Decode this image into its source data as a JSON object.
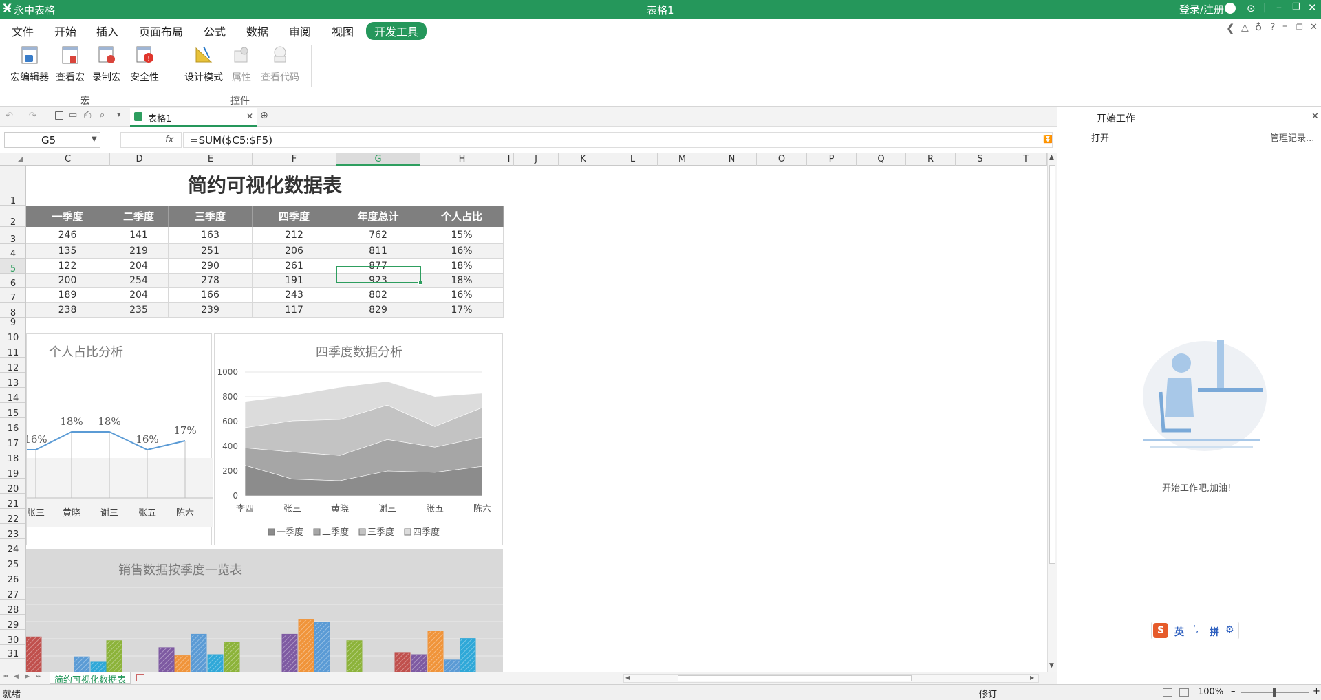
{
  "app": {
    "name": "永中表格",
    "doc_title": "表格1",
    "login": "登录/注册"
  },
  "menu": [
    "文件",
    "开始",
    "插入",
    "页面布局",
    "公式",
    "数据",
    "审阅",
    "视图",
    "开发工具"
  ],
  "ribbon": {
    "groups": [
      {
        "label": "宏"
      },
      {
        "label": "控件"
      }
    ],
    "buttons": [
      {
        "label": "宏编辑器",
        "icon": "macro-editor-icon",
        "enabled": true
      },
      {
        "label": "查看宏",
        "icon": "view-macro-icon",
        "enabled": true
      },
      {
        "label": "录制宏",
        "icon": "record-macro-icon",
        "enabled": true
      },
      {
        "label": "安全性",
        "icon": "security-icon",
        "enabled": true
      },
      {
        "label": "设计模式",
        "icon": "design-mode-icon",
        "enabled": true
      },
      {
        "label": "属性",
        "icon": "properties-icon",
        "enabled": false
      },
      {
        "label": "查看代码",
        "icon": "view-code-icon",
        "enabled": false
      }
    ]
  },
  "doc_tab": {
    "label": "表格1"
  },
  "formula_bar": {
    "name_box": "G5",
    "fx": "fx",
    "formula": "=SUM($C5:$F5)"
  },
  "columns": [
    "C",
    "D",
    "E",
    "F",
    "G",
    "H",
    "I",
    "J",
    "K",
    "L",
    "M",
    "N",
    "O",
    "P",
    "Q",
    "R",
    "S",
    "T"
  ],
  "rows": [
    "1",
    "2",
    "3",
    "4",
    "5",
    "6",
    "7",
    "8",
    "9",
    "10",
    "11",
    "12",
    "13",
    "14",
    "15",
    "16",
    "17",
    "18",
    "19",
    "20",
    "21",
    "22",
    "23",
    "24",
    "25",
    "26",
    "27",
    "28",
    "29",
    "30",
    "31"
  ],
  "sheet": {
    "title": "简约可视化数据表",
    "headers": [
      "一季度",
      "二季度",
      "三季度",
      "四季度",
      "年度总计",
      "个人占比"
    ],
    "data": [
      [
        "246",
        "141",
        "163",
        "212",
        "762",
        "15%"
      ],
      [
        "135",
        "219",
        "251",
        "206",
        "811",
        "16%"
      ],
      [
        "122",
        "204",
        "290",
        "261",
        "877",
        "18%"
      ],
      [
        "200",
        "254",
        "278",
        "191",
        "923",
        "18%"
      ],
      [
        "189",
        "204",
        "166",
        "243",
        "802",
        "16%"
      ],
      [
        "238",
        "235",
        "239",
        "117",
        "829",
        "17%"
      ]
    ]
  },
  "chart_data": [
    {
      "type": "line",
      "title": "个人占比分析",
      "categories": [
        "张三",
        "黄晓",
        "谢三",
        "张五",
        "陈六"
      ],
      "visible_category_labels": [
        "张三",
        "黄晓",
        "谢三",
        "张五",
        "陈六"
      ],
      "values": [
        16,
        18,
        18,
        16,
        17
      ],
      "data_labels": [
        "16%",
        "18%",
        "18%",
        "16%",
        "17%"
      ],
      "color": "#5b9bd5"
    },
    {
      "type": "area",
      "title": "四季度数据分析",
      "categories": [
        "李四",
        "张三",
        "黄晓",
        "谢三",
        "张五",
        "陈六"
      ],
      "ylim": [
        0,
        1000
      ],
      "yticks": [
        "0",
        "200",
        "400",
        "600",
        "800",
        "1000"
      ],
      "stacked": true,
      "series": [
        {
          "name": "一季度",
          "values": [
            246,
            135,
            122,
            200,
            189,
            238
          ],
          "color": "#8c8c8c"
        },
        {
          "name": "二季度",
          "values": [
            141,
            219,
            204,
            254,
            204,
            235
          ],
          "color": "#a6a6a6"
        },
        {
          "name": "三季度",
          "values": [
            163,
            251,
            290,
            278,
            166,
            239
          ],
          "color": "#c3c3c3"
        },
        {
          "name": "四季度",
          "values": [
            212,
            206,
            261,
            191,
            243,
            117
          ],
          "color": "#dcdcdc"
        }
      ],
      "legend": "bottom"
    },
    {
      "type": "bar",
      "title": "销售数据按季度一览表",
      "bars": [
        {
          "value": 65,
          "color": "#c0504d"
        },
        {
          "value": 0,
          "color": "#c0504d"
        },
        {
          "value": 28,
          "color": "#5b9bd5"
        },
        {
          "value": 18,
          "color": "#2fa8d8"
        },
        {
          "value": 58,
          "color": "#8cb33a"
        },
        {
          "value": 45,
          "color": "#7e5aa2"
        },
        {
          "value": 30,
          "color": "#f0943a"
        },
        {
          "value": 70,
          "color": "#5b9bd5"
        },
        {
          "value": 32,
          "color": "#2fa8d8"
        },
        {
          "value": 55,
          "color": "#8cb33a"
        },
        {
          "value": 70,
          "color": "#7e5aa2"
        },
        {
          "value": 98,
          "color": "#f0943a"
        },
        {
          "value": 92,
          "color": "#5b9bd5"
        },
        {
          "value": 0,
          "color": "#2fa8d8"
        },
        {
          "value": 58,
          "color": "#8cb33a"
        },
        {
          "value": 36,
          "color": "#c0504d"
        },
        {
          "value": 32,
          "color": "#7e5aa2"
        },
        {
          "value": 76,
          "color": "#f0943a"
        },
        {
          "value": 22,
          "color": "#5b9bd5"
        },
        {
          "value": 62,
          "color": "#2fa8d8"
        }
      ]
    }
  ],
  "sheet_tabs": [
    "简约可视化数据表"
  ],
  "status": {
    "ready": "就绪",
    "revise": "修订",
    "zoom": "100%"
  },
  "side_panel": {
    "title": "开始工作",
    "open": "打开",
    "manage": "管理记录...",
    "message": "开始工作吧,加油!"
  },
  "ime": {
    "lang": "英",
    "mode": "拼"
  },
  "colors": {
    "brand": "#25975b",
    "header_gray": "#7f7f7f",
    "selection": "#2e9e5f"
  }
}
